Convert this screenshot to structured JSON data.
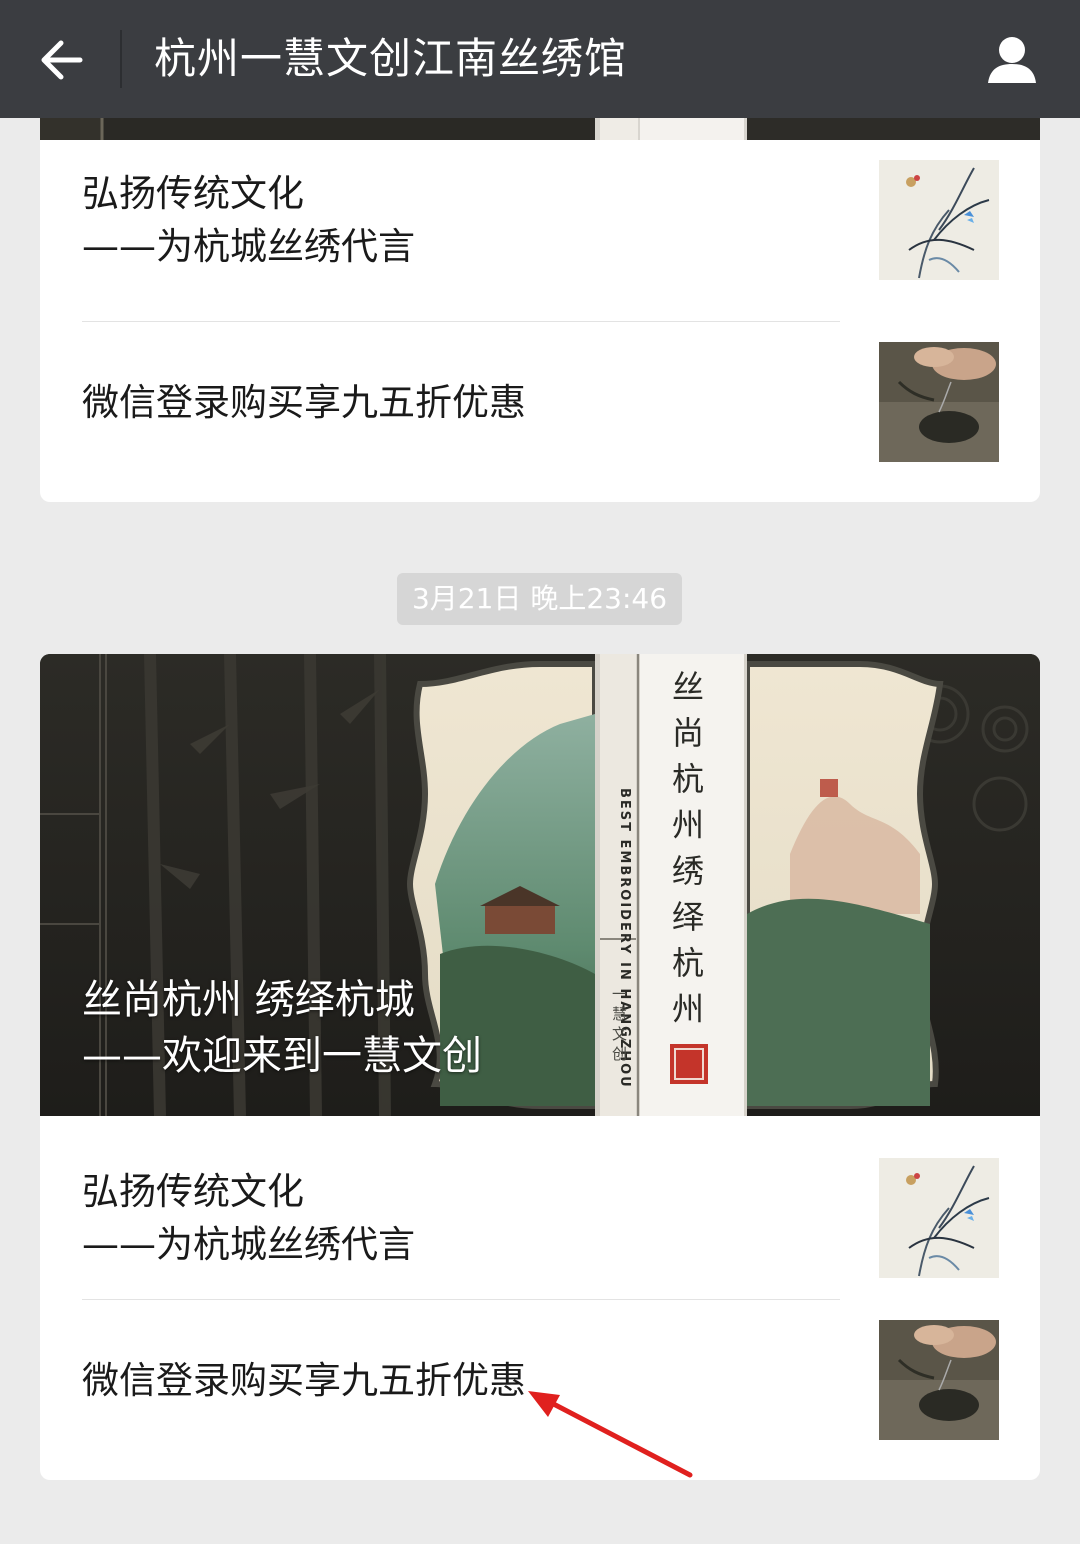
{
  "header": {
    "title": "杭州一慧文创江南丝绣馆",
    "back_icon": "arrow-left-icon",
    "profile_icon": "person-icon"
  },
  "message1": {
    "items": [
      {
        "line1": "弘扬传统文化",
        "line2": "——为杭城丝绣代言",
        "thumb": "orchid-painting"
      },
      {
        "line1": "微信登录购买享九五折优惠",
        "thumb": "embroidery-hands"
      }
    ]
  },
  "timestamp": "3月21日 晚上23:46",
  "message2": {
    "cover": {
      "title_line1": "丝尚杭州 绣绎杭城",
      "title_line2": "——欢迎来到一慧文创",
      "book_spine_cn": "丝尚杭州 绣绎杭州",
      "book_spine_en": "BEST EMBROIDERY IN HANGZHOU",
      "book_spine_small": "一慧文创"
    },
    "items": [
      {
        "line1": "弘扬传统文化",
        "line2": "——为杭城丝绣代言",
        "thumb": "orchid-painting"
      },
      {
        "line1": "微信登录购买享九五折优惠",
        "thumb": "embroidery-hands"
      }
    ]
  },
  "annotation": {
    "arrow_color": "#e0201e"
  }
}
